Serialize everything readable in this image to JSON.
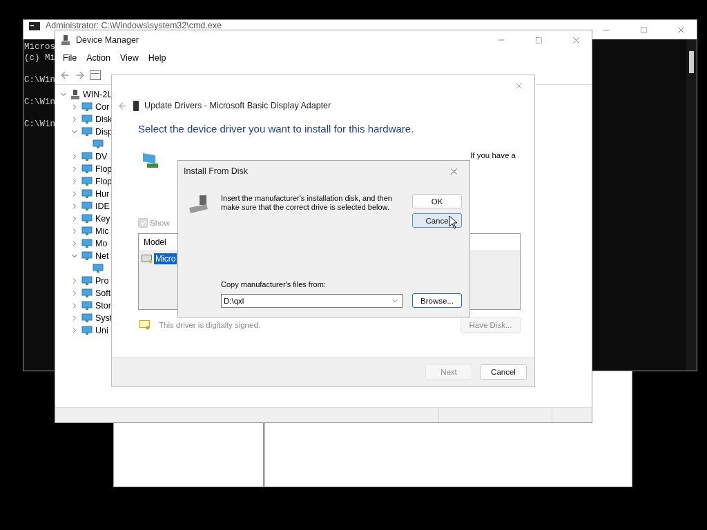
{
  "console_window": {
    "title": "Administrator: C:\\Windows\\system32\\cmd.exe",
    "header_lines": [
      "Micros",
      "(c) Mi"
    ],
    "prompt_lines": [
      "C:\\Win",
      "C:\\Win",
      "C:\\Win"
    ]
  },
  "device_manager": {
    "title": "Device Manager",
    "menu": [
      "File",
      "Action",
      "View",
      "Help"
    ],
    "tree": {
      "label": "WIN-2L",
      "expanded": true,
      "children": [
        {
          "kind": "category",
          "label": "Cor",
          "expanded": false
        },
        {
          "kind": "category",
          "label": "Disk",
          "expanded": false
        },
        {
          "kind": "category",
          "label": "Disp",
          "expanded": true,
          "children": [
            {
              "kind": "device"
            }
          ]
        },
        {
          "kind": "category",
          "label": "DV",
          "expanded": false
        },
        {
          "kind": "category",
          "label": "Flop",
          "expanded": false
        },
        {
          "kind": "category",
          "label": "Flop",
          "expanded": false
        },
        {
          "kind": "category",
          "label": "Hur",
          "expanded": false
        },
        {
          "kind": "category",
          "label": "IDE",
          "expanded": false
        },
        {
          "kind": "category",
          "label": "Key",
          "expanded": false
        },
        {
          "kind": "category",
          "label": "Mic",
          "expanded": false
        },
        {
          "kind": "category",
          "label": "Mo",
          "expanded": false
        },
        {
          "kind": "category",
          "label": "Net",
          "expanded": true,
          "children": [
            {
              "kind": "device"
            }
          ]
        },
        {
          "kind": "category",
          "label": "Pro",
          "expanded": false
        },
        {
          "kind": "category",
          "label": "Soft",
          "expanded": false
        },
        {
          "kind": "category",
          "label": "Stor",
          "expanded": false
        },
        {
          "kind": "category",
          "label": "Syst",
          "expanded": false
        },
        {
          "kind": "category",
          "label": "Uni",
          "expanded": false
        }
      ]
    }
  },
  "update_dialog": {
    "title": "Update Drivers - Microsoft Basic Display Adapter",
    "heading": "Select the device driver you want to install for this hardware.",
    "description": "If you have a",
    "show_compatible": {
      "label": "Show",
      "checked": true,
      "disabled": true
    },
    "list": {
      "columns": [
        "Model"
      ],
      "rows": [
        {
          "label": "Micro",
          "selected": true
        }
      ]
    },
    "signed_note": "This driver is digitally signed.",
    "have_disk": {
      "label": "Have Disk...",
      "disabled": true
    },
    "footer_buttons": [
      {
        "label": "Next",
        "disabled": true
      },
      {
        "label": "Cancel",
        "disabled": false
      }
    ]
  },
  "install_dialog": {
    "title": "Install From Disk",
    "message": "Insert the manufacturer's installation disk, and then\nmake sure that the correct drive is selected below.",
    "buttons": [
      {
        "label": "OK",
        "hovered": false
      },
      {
        "label": "Cance",
        "hovered": true
      }
    ],
    "path_label": "Copy manufacturer's files from:",
    "path_value": "D:\\qxl",
    "browse": "Browse..."
  }
}
